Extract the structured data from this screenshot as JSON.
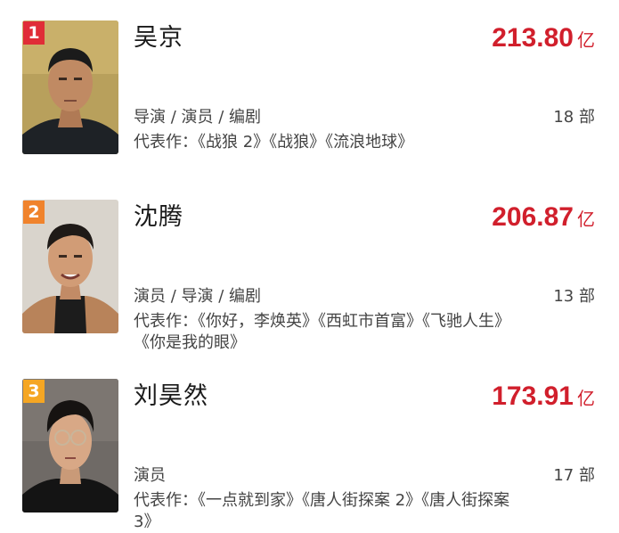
{
  "colors": {
    "box_office": "#d11f2c",
    "rank_1": "#e02d37",
    "rank_2": "#f0832c",
    "rank_3": "#f5a623"
  },
  "people": [
    {
      "rank": "1",
      "name": "吴京",
      "box_office": "213.80",
      "unit": "亿",
      "roles": "导演 / 演员 / 编剧",
      "count": "18 部",
      "works": "代表作：《战狼 2》《战狼》《流浪地球》",
      "photo": "portrait-photo"
    },
    {
      "rank": "2",
      "name": "沈腾",
      "box_office": "206.87",
      "unit": "亿",
      "roles": "演员 / 导演 / 编剧",
      "count": "13 部",
      "works": "代表作：《你好，李焕英》《西虹市首富》《飞驰人生》《你是我的眼》",
      "photo": "portrait-photo"
    },
    {
      "rank": "3",
      "name": "刘昊然",
      "box_office": "173.91",
      "unit": "亿",
      "roles": "演员",
      "count": "17 部",
      "works": "代表作：《一点就到家》《唐人街探案 2》《唐人街探案 3》",
      "photo": "portrait-photo"
    }
  ]
}
